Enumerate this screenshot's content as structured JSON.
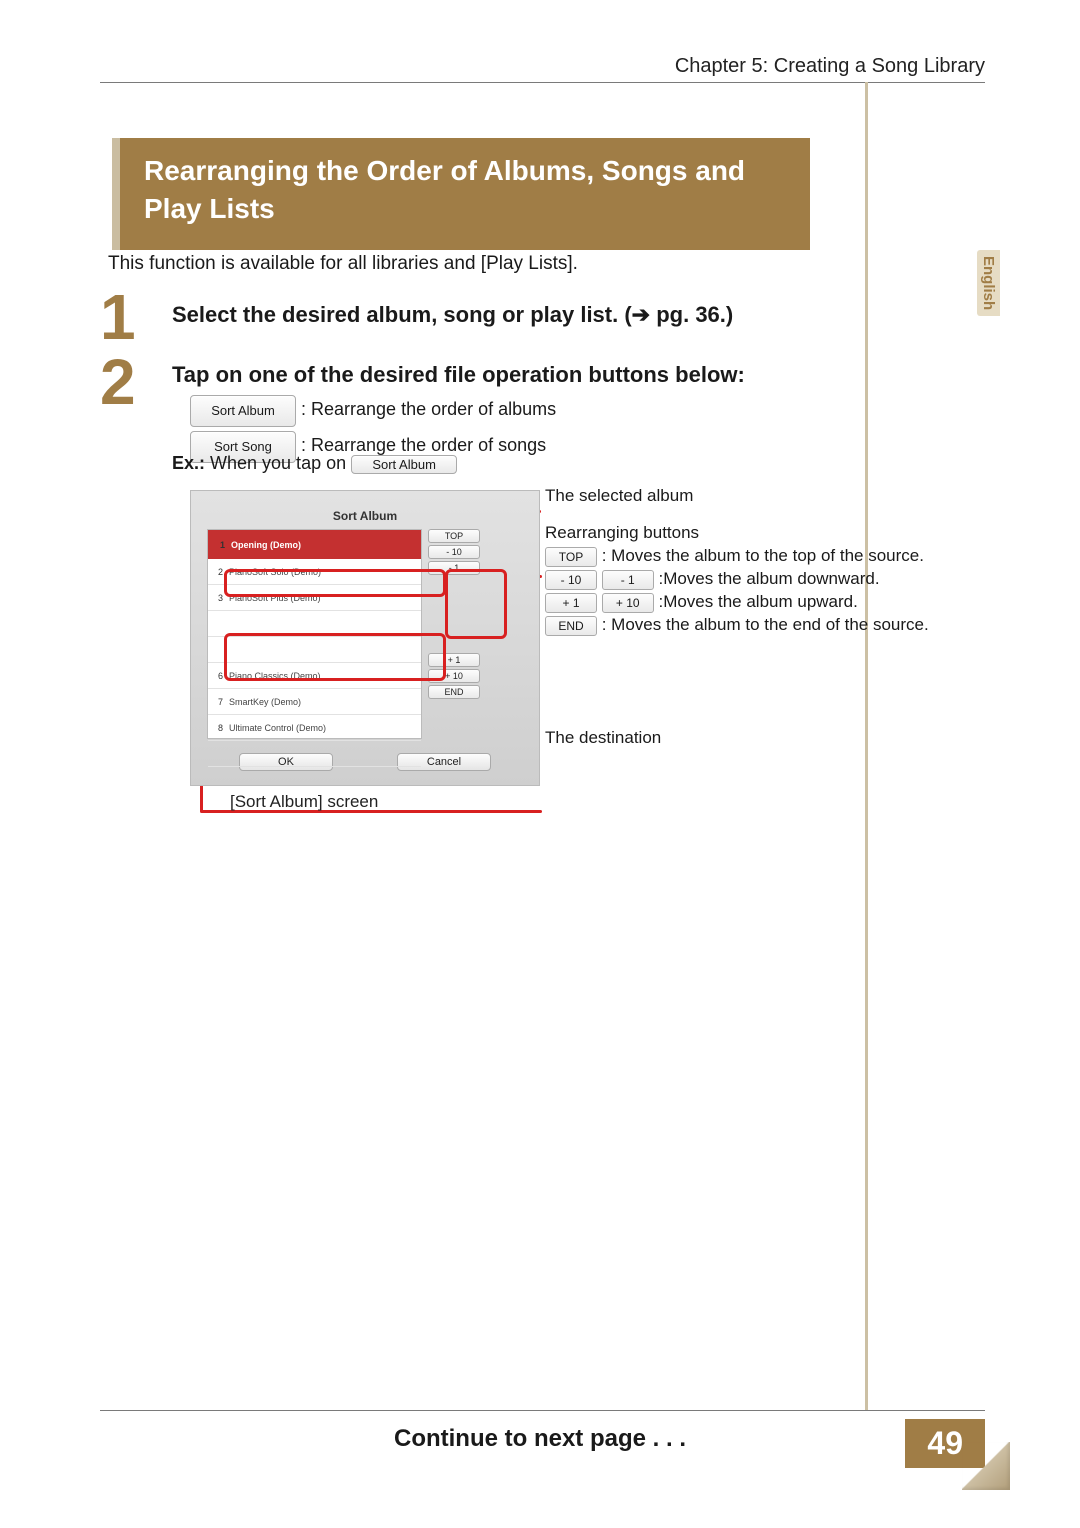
{
  "chapter": "Chapter 5: Creating a Song Library",
  "lang": "English",
  "title": "Rearranging the Order of Albums, Songs and Play Lists",
  "intro": "This function is available for all libraries and [Play Lists].",
  "step1": "Select the desired album, song or play list. (➔ pg. 36.)",
  "step2": "Tap on one of the desired file operation buttons below:",
  "buttons": {
    "sort_album": "Sort Album",
    "sort_song": "Sort Song"
  },
  "opt1_desc": ": Rearrange the order of albums",
  "opt2_desc": ": Rearrange the order of songs",
  "ex_prefix": "Ex.:",
  "ex_text": " When you tap on ",
  "screenshot": {
    "title": "Sort Album",
    "rows": [
      {
        "idx": "1",
        "name": "Opening (Demo)"
      },
      {
        "idx": "2",
        "name": "PianoSoft Solo (Demo)"
      },
      {
        "idx": "3",
        "name": "PianoSoft Plus (Demo)"
      },
      {
        "idx": "",
        "name": ""
      },
      {
        "idx": "",
        "name": ""
      },
      {
        "idx": "6",
        "name": "Piano Classics (Demo)"
      },
      {
        "idx": "7",
        "name": "SmartKey (Demo)"
      },
      {
        "idx": "8",
        "name": "Ultimate Control (Demo)"
      }
    ],
    "ctrl": {
      "top": "TOP",
      "m10": "- 10",
      "m1": "- 1",
      "p1": "+ 1",
      "p10": "+ 10",
      "end": "END"
    },
    "ok": "OK",
    "cancel": "Cancel",
    "caption": "[Sort Album] screen"
  },
  "annotations": {
    "selected": "The selected album",
    "rearr_title": "Rearranging buttons",
    "top_desc": " : Moves the album to the top of the source.",
    "down_desc": " :Moves the album downward.",
    "up_desc": " :Moves the album upward.",
    "end_desc": " : Moves the album to the end of the source.",
    "dest": "The destination"
  },
  "footer": {
    "continue": "Continue to next page . . .",
    "page": "49"
  }
}
